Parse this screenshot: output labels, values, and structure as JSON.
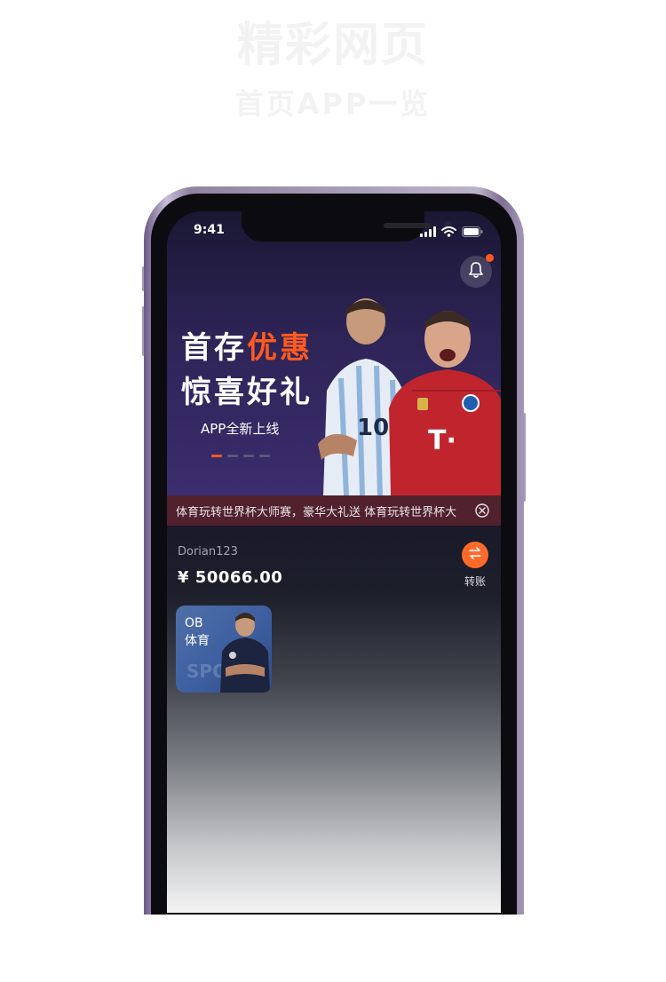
{
  "background": {
    "title": "精彩网页",
    "subtitle": "首页APP一览"
  },
  "statusbar": {
    "time": "9:41"
  },
  "notification": {
    "icon": "bell-icon",
    "badge_color": "#ff5a1f"
  },
  "banner": {
    "line1_a": "首存",
    "line1_b": "优惠",
    "line2": "惊喜好礼",
    "subtitle": "APP全新上线",
    "accent_color": "#ff5a1f",
    "dots_total": 4,
    "dots_active_index": 0
  },
  "marquee": {
    "text": "体育玩转世界杯大师赛，豪华大礼送  体育玩转世界杯大",
    "close_icon": "close-circle-icon"
  },
  "account": {
    "username": "Dorian123",
    "currency": "¥",
    "balance": "50066.00",
    "transfer_label": "转账",
    "transfer_icon": "swap-arrows-icon"
  },
  "games": [
    {
      "title": "OB\n体育",
      "bg_text": "SPO"
    }
  ]
}
